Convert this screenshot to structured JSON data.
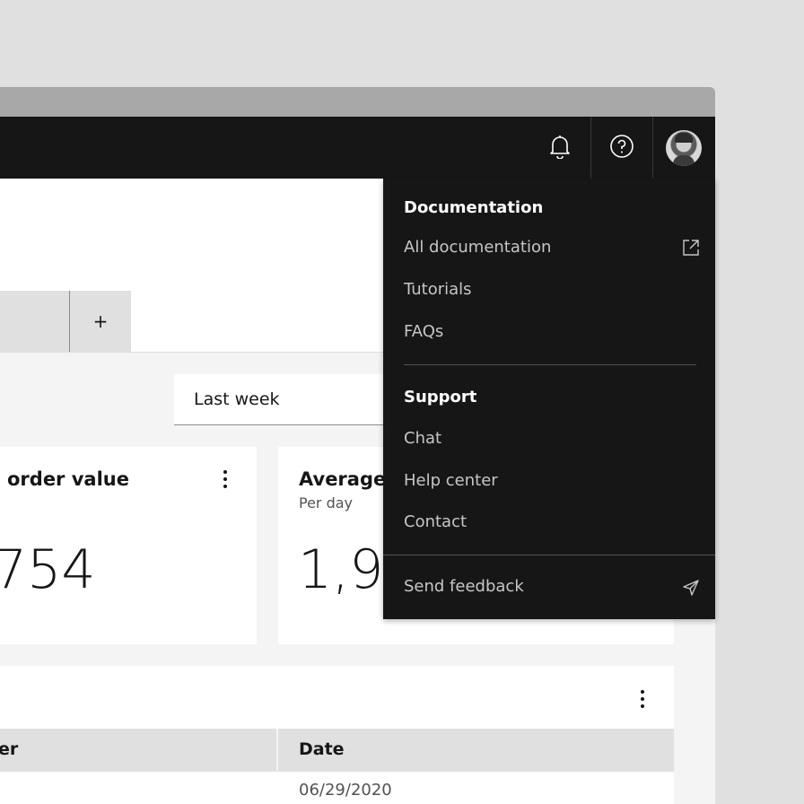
{
  "header": {
    "notifications_icon": "bell-icon",
    "help_icon": "help-circle-icon",
    "avatar_icon": "user-avatar"
  },
  "tabs": {
    "add_label": "+"
  },
  "filters": {
    "date_range": "Last week"
  },
  "cards": [
    {
      "title": "order value",
      "subtitle": "",
      "value": "754"
    },
    {
      "title": "Average",
      "subtitle": "Per day",
      "value": "1,9"
    }
  ],
  "table": {
    "columns": [
      "er",
      "Date"
    ],
    "rows": [
      {
        "date": "06/29/2020"
      }
    ]
  },
  "help_menu": {
    "documentation_heading": "Documentation",
    "documentation_items": [
      "All documentation",
      "Tutorials",
      "FAQs"
    ],
    "support_heading": "Support",
    "support_items": [
      "Chat",
      "Help center",
      "Contact"
    ],
    "feedback_label": "Send feedback",
    "external_link_icon": "launch-icon",
    "send_icon": "send-icon"
  },
  "colors": {
    "header_bg": "#161616",
    "menu_bg": "#161616",
    "page_bg": "#f4f4f4",
    "outer_bg": "#e0e0e0"
  }
}
